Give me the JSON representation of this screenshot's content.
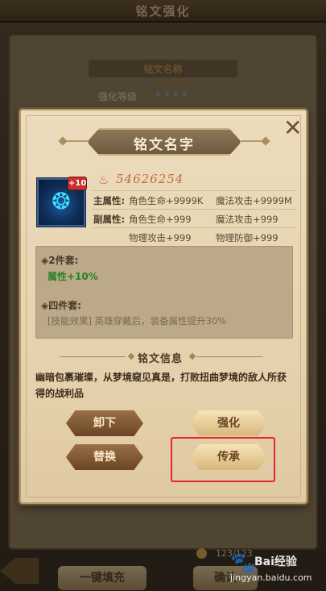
{
  "background": {
    "screen_title": "铭文强化",
    "item_name_bar": "铭文名称",
    "level_label": "强化等级",
    "stars": "★★★★",
    "count": "123/123",
    "fill_button": "一键填充",
    "confirm_button": "确认"
  },
  "modal": {
    "title": "铭文名字",
    "close_symbol": "✕",
    "item": {
      "level_badge": "+10",
      "glyph": "❂",
      "power_icon": "♨",
      "power": "54626254"
    },
    "attributes": {
      "main_label": "主属性:",
      "main_values": [
        "角色生命+9999K",
        "魔法攻击+9999M"
      ],
      "sub_label": "副属性:",
      "sub_values": [
        "角色生命+999",
        "魔法攻击+999",
        "物理攻击+999",
        "物理防御+999"
      ]
    },
    "set_bonus": {
      "two_piece_label": "◈2件套:",
      "two_piece_value": "属性+10%",
      "four_piece_label": "◈四件套:",
      "four_piece_value": "[技能效果] 英雄穿戴后，装备属性提升30%"
    },
    "info_title": "铭文信息",
    "description": "幽暗包裹璀璨，从梦境窥见真是，打败扭曲梦境的敌人所获得的战利品",
    "buttons": {
      "unload": "卸下",
      "enhance": "强化",
      "replace": "替换",
      "inherit": "传承"
    }
  },
  "watermark": {
    "paw": "🐾",
    "brand": "Bai经验",
    "site": "jingyan.baidu.com"
  },
  "colors": {
    "highlight_outline": "#e5262a",
    "power_text": "#c46a45",
    "set_value_green": "#2f7f28"
  }
}
